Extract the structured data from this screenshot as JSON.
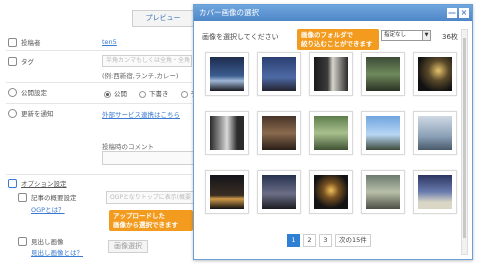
{
  "form": {
    "preview_label": "プレビュー",
    "author_label": "投稿者",
    "author_value": "ten5",
    "tags_label": "タグ",
    "tags_placeholder": "半角カンマもしくは全角・全角",
    "tags_example": "(例:西新宿,ランチ,カレー)",
    "publish_label": "公開設定",
    "publish_options": [
      "公開",
      "下書き",
      "予"
    ],
    "notify_label": "更新を通知",
    "notify_link": "外部サービス連携はこちら",
    "comment_label": "投稿時のコメント",
    "options_toggle": "オプション設定",
    "summary_label": "記事の概要設定",
    "summary_help": "OGPとは？",
    "summary_placeholder": "OGPとなりトップに表示(概要",
    "cover_label": "見出し画像",
    "cover_help": "見出し画像とは？",
    "cover_button": "画像選択"
  },
  "callouts": {
    "upload": [
      "アップロードした",
      "画像から選択できます"
    ],
    "folder": [
      "画像のフォルダで",
      "絞り込むことができます"
    ]
  },
  "modal": {
    "title": "カバー画像の選択",
    "minimize_symbol": "—",
    "close_symbol": "×",
    "instruction": "画像を選択してください",
    "folder_value": "指定なし",
    "count": "36枚",
    "thumbnails": [
      "night-sky-photo",
      "dusk-sky-photo",
      "dark-room-photo",
      "garden-photo",
      "night-lights-photo",
      "window-grid-photo",
      "indoor-photo",
      "tree-photo",
      "blue-sky-photo",
      "tower-photo",
      "street-night-photo",
      "dusk-street-photo",
      "lantern-photo",
      "gate-photo",
      "station-photo"
    ],
    "pager": {
      "pages": [
        "1",
        "2",
        "3"
      ],
      "active": "1",
      "next": "次の15件"
    }
  },
  "colors": {
    "titlebar": "#4f86c7",
    "callout": "#f39b1e",
    "pager_active": "#2f7fd3"
  }
}
